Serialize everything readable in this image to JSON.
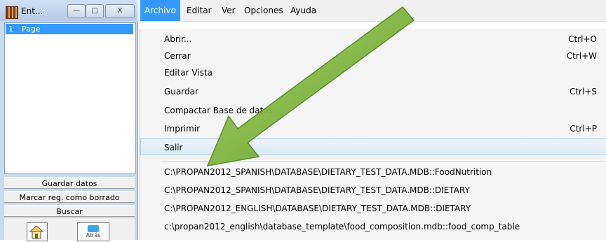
{
  "window": {
    "title": "Ent...",
    "controls": {
      "minimize": "—",
      "maximize": "□",
      "close": "X"
    },
    "list_items": [
      {
        "number": "1",
        "label": "Page"
      }
    ],
    "buttons": {
      "save": "Guardar datos",
      "mark_deleted": "Marcar reg. como borrado",
      "search": "Buscar",
      "back": "Atrás"
    }
  },
  "menubar": {
    "items": [
      "Archivo",
      "Editar",
      "Ver",
      "Opciones",
      "Ayuda"
    ],
    "active": "Archivo"
  },
  "archivo_menu": {
    "items": [
      {
        "label": "Abrir...",
        "shortcut": "Ctrl+O"
      },
      {
        "label": "Cerrar",
        "shortcut": "Ctrl+W"
      },
      {
        "label": "Editar Vista",
        "shortcut": ""
      },
      {
        "label": "Guardar",
        "shortcut": "Ctrl+S"
      },
      {
        "label": "Compactar Base de datos",
        "shortcut": ""
      },
      {
        "label": "Imprimir",
        "shortcut": "Ctrl+P"
      },
      {
        "label": "Salir",
        "shortcut": ""
      }
    ],
    "highlighted": "Salir",
    "recent_files": [
      "C:\\PROPAN2012_SPANISH\\DATABASE\\DIETARY_TEST_DATA.MDB::FoodNutrition",
      "C:\\PROPAN2012_SPANISH\\DATABASE\\DIETARY_TEST_DATA.MDB::DIETARY",
      "C:\\PROPAN2012_ENGLISH\\DATABASE\\DIETARY_TEST_DATA.MDB::DIETARY",
      "c:\\propan2012_english\\database_template\\food_composition.mdb::food_comp_table"
    ]
  },
  "colors": {
    "accent": "#3399ff",
    "arrow": "#7fb640",
    "window_chrome": "#c9d9ee"
  },
  "icons": [
    "app-icon",
    "home-icon",
    "back-arrow-icon",
    "pointer-arrow"
  ]
}
